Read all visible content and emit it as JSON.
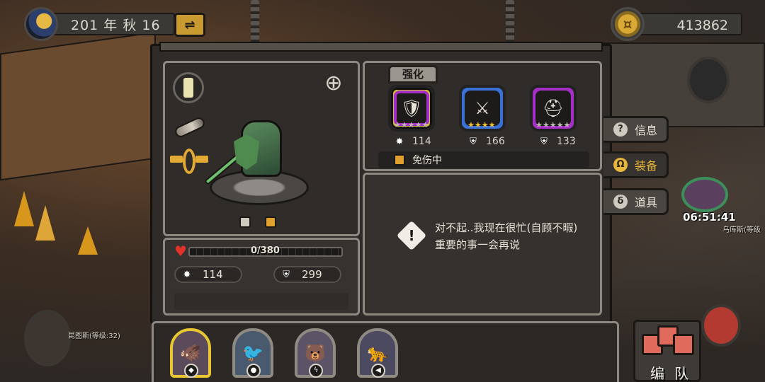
{
  "hud": {
    "date": "201 年 秋 16",
    "gold": "413862"
  },
  "character": {
    "hp_current": 0,
    "hp_max": 380,
    "hp_text": "0/380",
    "attack": "114",
    "defense": "299"
  },
  "equipment": {
    "strengthen_label": "强化",
    "slots": [
      {
        "icon": "spiked-shield-icon",
        "rarity_color": "#a52ec6",
        "stars": 5,
        "stat_type": "attack",
        "value": "114"
      },
      {
        "icon": "spiked-armor-icon",
        "rarity_color": "#3a6fd6",
        "stars": 4,
        "stat_type": "defense",
        "value": "166"
      },
      {
        "icon": "green-helmet-icon",
        "rarity_color": "#a52ec6",
        "stars": 5,
        "stat_type": "defense",
        "value": "133"
      }
    ],
    "status_label": "免伤中"
  },
  "message": {
    "text": "对不起..我现在很忙(自顾不暇)重要的事一会再说"
  },
  "side_tabs": [
    {
      "label": "信息",
      "icon": "info-icon",
      "active": false
    },
    {
      "label": "装备",
      "icon": "helmet-icon",
      "active": true
    },
    {
      "label": "道具",
      "icon": "potion-icon",
      "active": false
    }
  ],
  "map": {
    "timer": "06:51:41",
    "enemy_label": "乌库斯(等级",
    "town_label": "昆图斯(等级:32)"
  },
  "bottom_bar": {
    "heroes": [
      {
        "name": "warrior-hero",
        "selected": true
      },
      {
        "name": "seagull-hero",
        "selected": false
      },
      {
        "name": "polar-bear-hero",
        "selected": false
      },
      {
        "name": "cheetah-hero",
        "selected": false
      }
    ],
    "team_label": "编 队"
  },
  "colors": {
    "gold_accent": "#e8b63a",
    "hp_red": "#c23a2a",
    "epic_purple": "#a52ec6",
    "rare_blue": "#3a6fd6",
    "selected_yellow": "#e8c632"
  }
}
